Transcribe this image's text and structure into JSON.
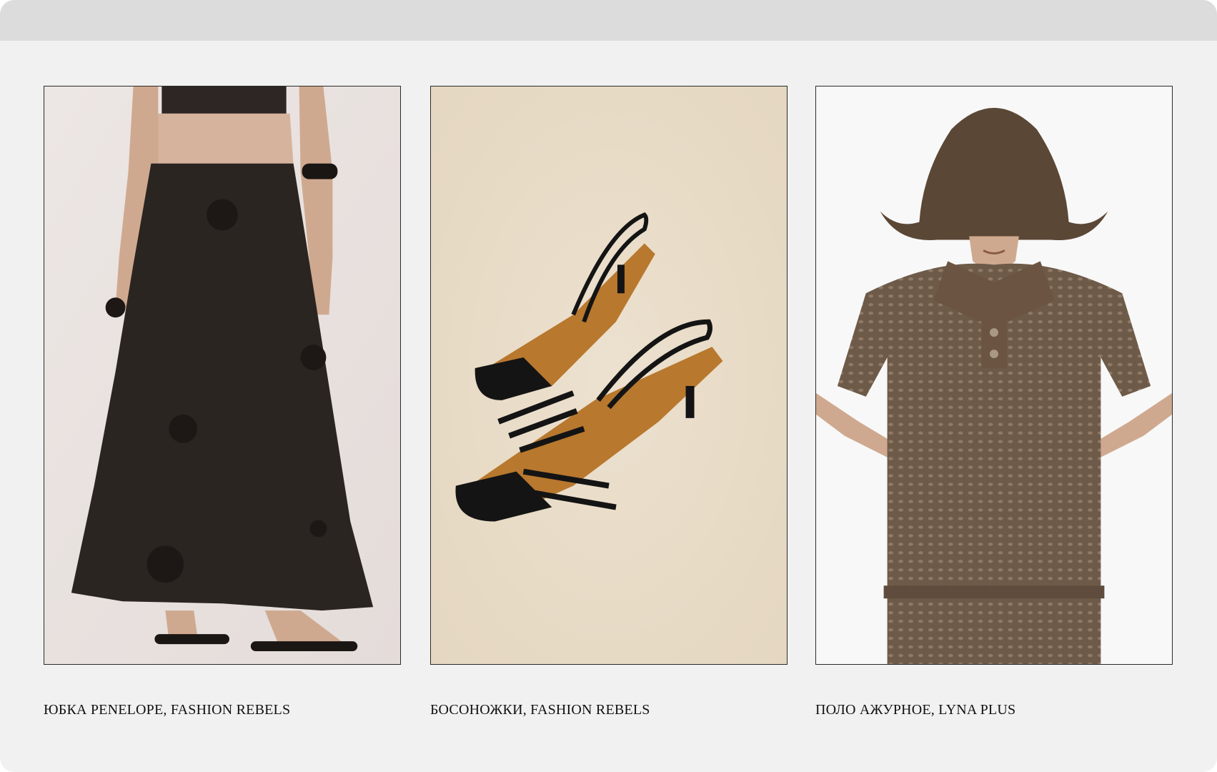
{
  "products": [
    {
      "caption": "ЮБКА PENELOPE, FASHION REBELS",
      "image_icon": "skirt-photo"
    },
    {
      "caption": "БОСОНОЖКИ, FASHION REBELS",
      "image_icon": "sandals-photo"
    },
    {
      "caption": "ПОЛО АЖУРНОЕ, LYNA PLUS",
      "image_icon": "polo-photo"
    }
  ],
  "colors": {
    "page_bg": "#f1f1f1",
    "topbar": "#dcdcdc",
    "text": "#111111",
    "skirt": "#2b2522",
    "sandal_leather": "#141414",
    "sandal_insole": "#b8782e",
    "knit": "#6e5a48"
  }
}
